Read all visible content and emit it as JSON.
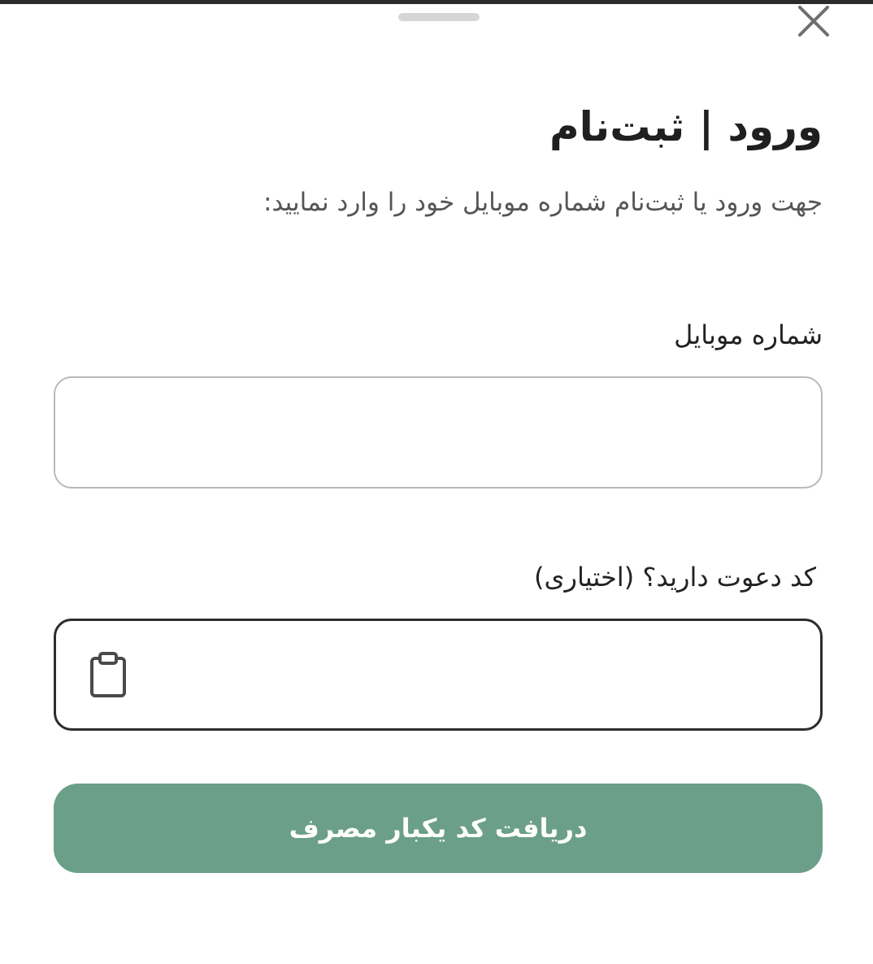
{
  "sheet": {
    "title": "ورود | ثبت‌نام",
    "subtitle": "جهت ورود یا ثبت‌نام شماره موبایل خود را وارد نمایید:"
  },
  "mobile_field": {
    "label": "شماره موبایل",
    "value": "",
    "placeholder": ""
  },
  "invite_field": {
    "label": "کد دعوت دارید؟ (اختیاری)",
    "value": "",
    "placeholder": ""
  },
  "submit": {
    "label": "دریافت کد یکبار مصرف"
  },
  "icons": {
    "close": "close-icon",
    "paste": "clipboard-icon"
  },
  "colors": {
    "accent": "#6b9f89",
    "text": "#222222",
    "muted": "#555555",
    "input_border": "#b9b9b9",
    "input_border_active": "#2d2d2d"
  }
}
